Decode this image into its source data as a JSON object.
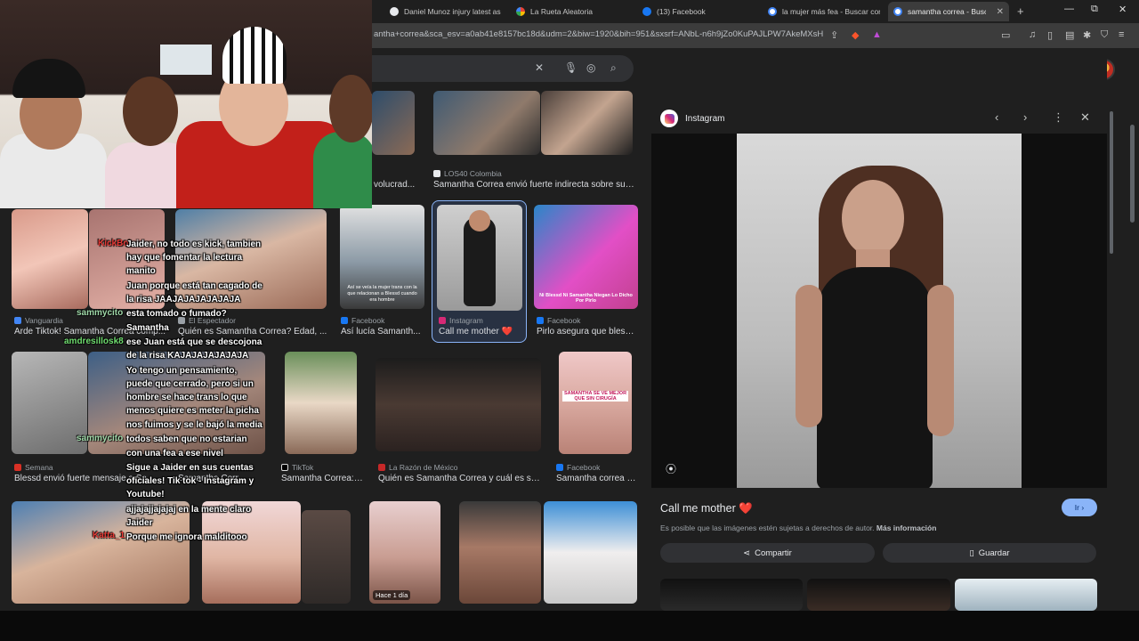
{
  "browser": {
    "tabs": [
      {
        "title": "Daniel Munoz injury latest as C",
        "color": "#e8eaed"
      },
      {
        "title": "La Rueta Aleatoria",
        "color": "#34a853"
      },
      {
        "title": "(13) Facebook",
        "color": "#1877f2"
      },
      {
        "title": "la mujer más fea - Buscar con G",
        "color": "#ffffff"
      },
      {
        "title": "samantha correa - Buscar",
        "color": "#ffffff"
      }
    ],
    "url": "antha+correa&sca_esv=a0ab41e8157bc18d&udm=2&biw=1920&bih=951&sxsrf=ANbL-n6h9jZo0KuPAJLPW7AkeMXsHw..."
  },
  "grid": {
    "row1": [
      {
        "source": "",
        "caption": "volucrad..."
      },
      {
        "source": "LOS40 Colombia",
        "caption": "Samantha Correa envió fuerte indirecta sobre su s..."
      }
    ],
    "row2": [
      {
        "source": "Vanguardia",
        "caption": "Arde Tiktok! Samantha Correa comp..."
      },
      {
        "source": "El Espectador",
        "caption": "Quién es Samantha Correa? Edad, ..."
      },
      {
        "source": "Facebook",
        "caption": "Así lucía Samanth..."
      },
      {
        "source": "Instagram",
        "caption": "Call me mother ❤️"
      },
      {
        "source": "Facebook",
        "caption": "Pirlo asegura que bless..."
      }
    ],
    "row3": [
      {
        "source": "Semana",
        "caption": "Blessd envió fuerte mensaje a Saman..."
      },
      {
        "source": "",
        "caption": "Samantha Corr..."
      },
      {
        "source": "TikTok",
        "caption": "Samantha Correa: ..."
      },
      {
        "source": "La Razón de México",
        "caption": "Quién es Samantha Correa y cuál es su..."
      },
      {
        "source": "Facebook",
        "caption": "Samantha correa y..."
      }
    ],
    "badge_time": "Hace 1 día",
    "thumb_texts": {
      "t1": "Así se veía la mujer trans con la que relacionan a Blessd cuando era hombre",
      "t2": "Ni Blessd Ni Samantha Niegan Lo Dicho Por Pirlo",
      "t3": "SAMANTHA SE VE MEJOR QUE SIN CIRUGÍA"
    }
  },
  "panel": {
    "source": "Instagram",
    "title": "Call me mother ❤️",
    "go_label": "Ir",
    "notice": "Es posible que las imágenes estén sujetas a derechos de autor.",
    "notice_link": "Más información",
    "share_label": "Compartir",
    "save_label": "Guardar"
  },
  "chat": [
    {
      "user": "",
      "text": "Jaider, no todo es kick, tambien"
    },
    {
      "user": "",
      "text": "hay que fomentar la lectura"
    },
    {
      "user": "",
      "text": "manito"
    },
    {
      "user": "",
      "text": "Juan porque está tan cagado de"
    },
    {
      "user": "",
      "text": "la risa JAAJAJAJAJAJAJA"
    },
    {
      "user": "sammycito",
      "text": "esta tomado o fumado?"
    },
    {
      "user": "",
      "text": "Samantha"
    },
    {
      "user": "amdresillosk8",
      "text": "ese Juan está que se descojona"
    },
    {
      "user": "",
      "text": "de la risa KAJAJAJAJAJAJA"
    },
    {
      "user": "",
      "text": "Yo tengo un pensamiento,"
    },
    {
      "user": "",
      "text": "puede que cerrado, pero si un"
    },
    {
      "user": "",
      "text": "hombre se hace trans lo que"
    },
    {
      "user": "",
      "text": "menos quiere es meter la picha"
    },
    {
      "user": "",
      "text": "nos fuimos y se le bajó la media"
    },
    {
      "user": "sammycito",
      "text": "todos saben que no estarian"
    },
    {
      "user": "",
      "text": "con una fea a ese nivel"
    },
    {
      "user": "",
      "text": "Sigue a Jaider en sus cuentas"
    },
    {
      "user": "",
      "text": "oficiales! Tik tok - Instagram y"
    },
    {
      "user": "",
      "text": "Youtube!"
    },
    {
      "user": "",
      "text": "ajjajajjajajaj en la mente claro"
    },
    {
      "user": "",
      "text": "Jaider"
    },
    {
      "user": "",
      "text": "Porque me ignora malditooo"
    }
  ],
  "chat_users": {
    "u1": "KickBot",
    "u2": "Katta_1"
  }
}
